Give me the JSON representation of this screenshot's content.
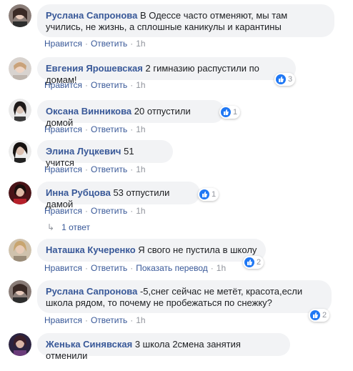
{
  "actions": {
    "like": "Нравится",
    "reply": "Ответить",
    "translate": "Показать перевод",
    "sep": "·"
  },
  "comments": [
    {
      "author": "Руслана Сапронова",
      "text": "В Одессе часто отменяют, мы там учились, не жизнь, а сплошные каникулы и карантины",
      "time": "1h",
      "likes": ""
    },
    {
      "author": "Евгения Ярошевская",
      "text": "2 гимназию распустили по домам!",
      "time": "1h",
      "likes": "3"
    },
    {
      "author": "Оксана Винникова",
      "text": "20 отпустили домой",
      "time": "1h",
      "likes": "1"
    },
    {
      "author": "Элина Луцкевич",
      "text": "51 учится",
      "time": "1h",
      "likes": ""
    },
    {
      "author": "Инна Рубцова",
      "text": "53 отпустили дамой",
      "time": "1h",
      "likes": "1"
    },
    {
      "author": "Наташка Кучеренко",
      "text": "Я свого не пустила в школу",
      "time": "1h",
      "likes": "2"
    },
    {
      "author": "Руслана Сапронова",
      "text": "-5,снег сейчас не метёт, красота,если школа рядом, то почему не пробежаться по снежку?",
      "time": "1h",
      "likes": "2"
    },
    {
      "author": "Женька Синявская",
      "text": "3 школа 2смена занятия отменили",
      "time": "",
      "likes": ""
    }
  ],
  "replies_link": {
    "arrow": "↳",
    "label": "1 ответ"
  },
  "colors": {
    "link": "#385898",
    "meta": "#90949c",
    "bubble": "#f2f3f5",
    "like": "#2078f4"
  }
}
